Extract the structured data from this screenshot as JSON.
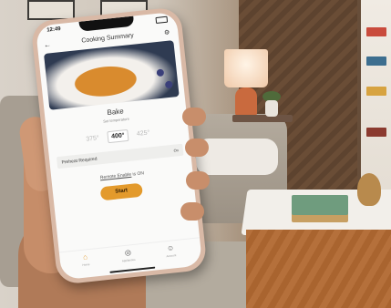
{
  "status_bar": {
    "time": "12:49"
  },
  "header": {
    "title": "Cooking Summary",
    "back_icon": "back-arrow-icon",
    "action_icon": "settings-icon"
  },
  "hero_image": {
    "subject": "muffin"
  },
  "cooking": {
    "mode": "Bake",
    "temperature_label": "Set temperature",
    "temperature_options": [
      "375°",
      "400°",
      "425°"
    ],
    "selected_temperature": "400°"
  },
  "preheat": {
    "label": "Preheat Required",
    "value": "On"
  },
  "remote": {
    "link_text": "Remote Enable",
    "suffix": " is ON"
  },
  "start_button": {
    "label": "Start"
  },
  "tabs": [
    {
      "icon": "home-icon",
      "label": "Home"
    },
    {
      "icon": "appliance-icon",
      "label": "Appliances"
    },
    {
      "icon": "profile-icon",
      "label": "Account"
    }
  ],
  "colors": {
    "accent": "#e39a2c",
    "active_tab": "#e39a2c"
  }
}
